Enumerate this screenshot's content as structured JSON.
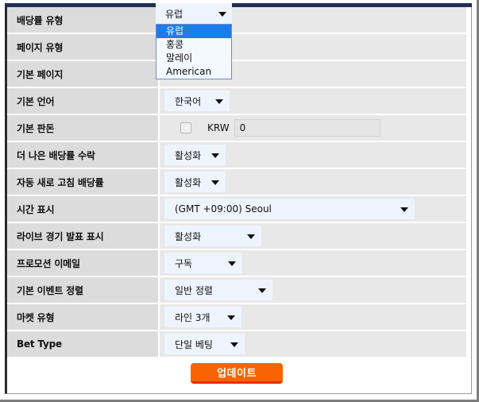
{
  "form": {
    "rows": [
      {
        "label": "배당률 유형",
        "control": "select-open",
        "value": "유럽"
      },
      {
        "label": "페이지 유형",
        "control": "select-hidden",
        "value": ""
      },
      {
        "label": "기본 페이지",
        "control": "select-peek",
        "value": ""
      },
      {
        "label": "기본 언어",
        "control": "select",
        "value": "한국어"
      },
      {
        "label": "기본 판돈",
        "control": "stake",
        "value": "0"
      },
      {
        "label": "더 나은 배당률 수락",
        "control": "select",
        "value": "활성화"
      },
      {
        "label": "자동 새로 고침 배당률",
        "control": "select",
        "value": "활성화"
      },
      {
        "label": "시간 표시",
        "control": "select",
        "value": "(GMT +09:00) Seoul"
      },
      {
        "label": "라이브 경기 발표 표시",
        "control": "select",
        "value": "활성화"
      },
      {
        "label": "프로모션 이메일",
        "control": "select",
        "value": "구독"
      },
      {
        "label": "기본 이벤트 정렬",
        "control": "select",
        "value": "일반 정렬"
      },
      {
        "label": "마켓 유형",
        "control": "select",
        "value": "라인 3개"
      },
      {
        "label": "Bet Type",
        "control": "select",
        "value": "단일 베팅"
      }
    ],
    "odds_dropdown": {
      "selected": "유럽",
      "options": [
        "유럽",
        "홍콩",
        "말레이",
        "American"
      ]
    },
    "stake": {
      "currency": "KRW",
      "amount": "0",
      "checkbox_checked": false
    },
    "update_label": "업데이트"
  },
  "colors": {
    "label_bg": "#dcdcdc",
    "field_bg": "#e8e8e8",
    "select_bg": "#eef4fd",
    "highlight": "#1b7ced",
    "button": "#f96302",
    "button_shadow": "#e53000",
    "top_rule": "#1f2f55"
  }
}
